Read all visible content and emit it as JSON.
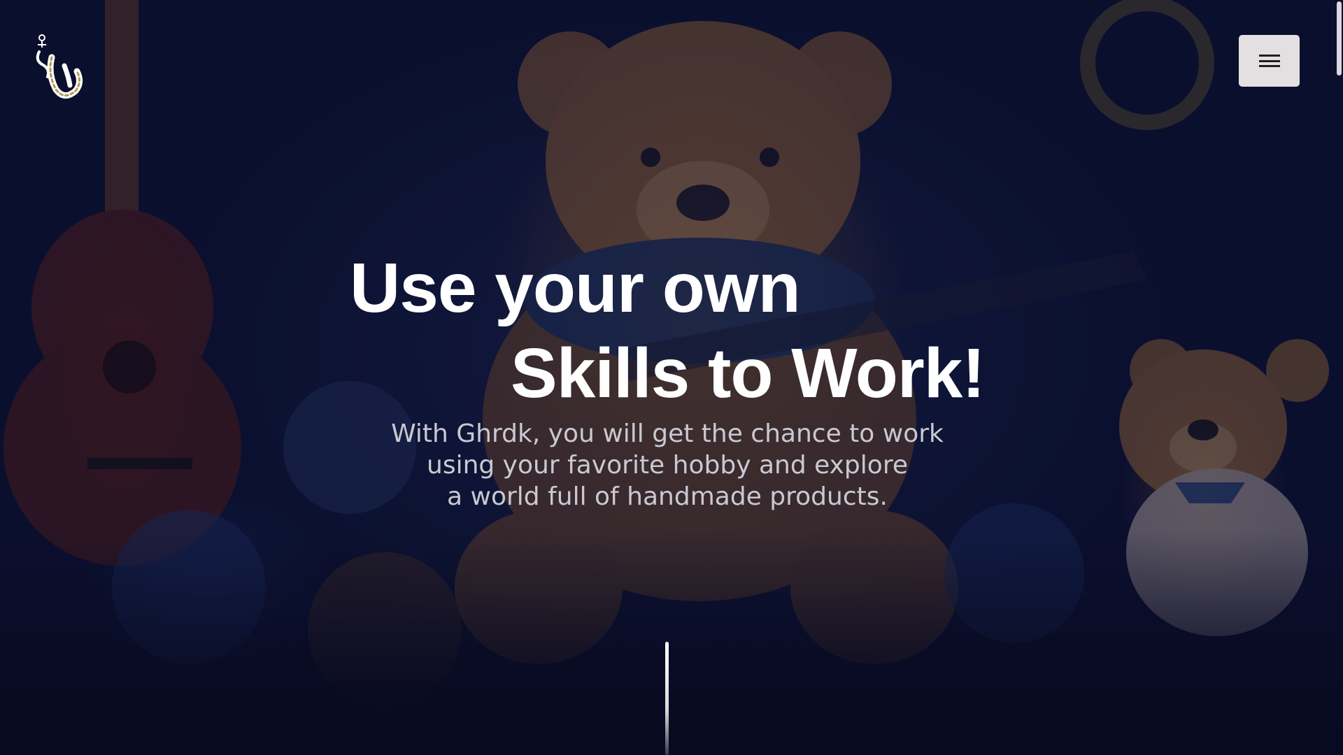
{
  "colors": {
    "background": "#0b1030",
    "headline": "#ffffff",
    "subtext": "#c9c9d2",
    "menu_button": "#e4e0e1"
  },
  "header": {
    "logo_icon": "ghrdk-logo-icon",
    "menu_icon": "hamburger-menu-icon"
  },
  "hero": {
    "headline_line1": "Use your own",
    "headline_line2": "Skills to Work!",
    "subtext_lines": [
      "With Ghrdk, you will get the chance to work",
      "using your favorite hobby and explore",
      "a world full of handmade products."
    ],
    "scroll_indicator_icon": "scroll-down-line-icon"
  }
}
